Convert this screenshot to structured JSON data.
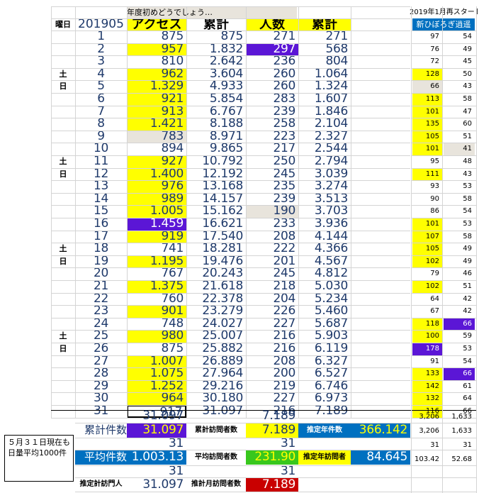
{
  "sheet": {
    "note_top": "年度初めどうでしょう…",
    "note_top_right": "2019年1月再スタート",
    "sub_header": "新ひぼろぎ逍遥",
    "headers": {
      "weekday": "曜日",
      "month": "201905",
      "access": "アクセス",
      "cum_access": "累計",
      "visitors": "人数",
      "cum_visitors": "累計"
    },
    "rows": [
      {
        "wd": "",
        "d": "1",
        "a": "875",
        "ca": "875",
        "v": "271",
        "cv": "271",
        "n1": "97",
        "n2": "54"
      },
      {
        "wd": "",
        "d": "2",
        "a": "957",
        "ca": "1.832",
        "v": "297",
        "cv": "568",
        "n1": "76",
        "n2": "49"
      },
      {
        "wd": "",
        "d": "3",
        "a": "810",
        "ca": "2.642",
        "v": "236",
        "cv": "804",
        "n1": "72",
        "n2": "45"
      },
      {
        "wd": "土",
        "d": "4",
        "a": "962",
        "ca": "3.604",
        "v": "260",
        "cv": "1.064",
        "n1": "128",
        "n2": "50"
      },
      {
        "wd": "日",
        "d": "5",
        "a": "1.329",
        "ca": "4.933",
        "v": "260",
        "cv": "1.324",
        "n1": "66",
        "n2": "43"
      },
      {
        "wd": "",
        "d": "6",
        "a": "921",
        "ca": "5.854",
        "v": "283",
        "cv": "1.607",
        "n1": "113",
        "n2": "58"
      },
      {
        "wd": "",
        "d": "7",
        "a": "913",
        "ca": "6.767",
        "v": "239",
        "cv": "1.846",
        "n1": "101",
        "n2": "47"
      },
      {
        "wd": "",
        "d": "8",
        "a": "1.421",
        "ca": "8.188",
        "v": "258",
        "cv": "2.104",
        "n1": "135",
        "n2": "60"
      },
      {
        "wd": "",
        "d": "9",
        "a": "783",
        "ca": "8.971",
        "v": "223",
        "cv": "2.327",
        "n1": "105",
        "n2": "51"
      },
      {
        "wd": "",
        "d": "10",
        "a": "894",
        "ca": "9.865",
        "v": "217",
        "cv": "2.544",
        "n1": "101",
        "n2": "41"
      },
      {
        "wd": "土",
        "d": "11",
        "a": "927",
        "ca": "10.792",
        "v": "250",
        "cv": "2.794",
        "n1": "95",
        "n2": "48"
      },
      {
        "wd": "日",
        "d": "12",
        "a": "1.400",
        "ca": "12.192",
        "v": "245",
        "cv": "3.039",
        "n1": "111",
        "n2": "43"
      },
      {
        "wd": "",
        "d": "13",
        "a": "976",
        "ca": "13.168",
        "v": "235",
        "cv": "3.274",
        "n1": "93",
        "n2": "53"
      },
      {
        "wd": "",
        "d": "14",
        "a": "989",
        "ca": "14.157",
        "v": "239",
        "cv": "3.513",
        "n1": "90",
        "n2": "58"
      },
      {
        "wd": "",
        "d": "15",
        "a": "1.005",
        "ca": "15.162",
        "v": "190",
        "cv": "3.703",
        "n1": "86",
        "n2": "54"
      },
      {
        "wd": "",
        "d": "16",
        "a": "1.459",
        "ca": "16.621",
        "v": "233",
        "cv": "3.936",
        "n1": "101",
        "n2": "53"
      },
      {
        "wd": "",
        "d": "17",
        "a": "919",
        "ca": "17.540",
        "v": "208",
        "cv": "4.144",
        "n1": "107",
        "n2": "58"
      },
      {
        "wd": "土",
        "d": "18",
        "a": "741",
        "ca": "18.281",
        "v": "222",
        "cv": "4.366",
        "n1": "105",
        "n2": "49"
      },
      {
        "wd": "日",
        "d": "19",
        "a": "1.195",
        "ca": "19.476",
        "v": "201",
        "cv": "4.567",
        "n1": "102",
        "n2": "49"
      },
      {
        "wd": "",
        "d": "20",
        "a": "767",
        "ca": "20.243",
        "v": "245",
        "cv": "4.812",
        "n1": "79",
        "n2": "46"
      },
      {
        "wd": "",
        "d": "21",
        "a": "1.375",
        "ca": "21.618",
        "v": "218",
        "cv": "5.030",
        "n1": "102",
        "n2": "51"
      },
      {
        "wd": "",
        "d": "22",
        "a": "760",
        "ca": "22.378",
        "v": "204",
        "cv": "5.234",
        "n1": "64",
        "n2": "42"
      },
      {
        "wd": "",
        "d": "23",
        "a": "901",
        "ca": "23.279",
        "v": "226",
        "cv": "5.460",
        "n1": "67",
        "n2": "42"
      },
      {
        "wd": "",
        "d": "24",
        "a": "748",
        "ca": "24.027",
        "v": "227",
        "cv": "5.687",
        "n1": "118",
        "n2": "66"
      },
      {
        "wd": "土",
        "d": "25",
        "a": "980",
        "ca": "25.007",
        "v": "216",
        "cv": "5.903",
        "n1": "100",
        "n2": "59"
      },
      {
        "wd": "日",
        "d": "26",
        "a": "875",
        "ca": "25.882",
        "v": "216",
        "cv": "6.119",
        "n1": "178",
        "n2": "53"
      },
      {
        "wd": "",
        "d": "27",
        "a": "1.007",
        "ca": "26.889",
        "v": "208",
        "cv": "6.327",
        "n1": "91",
        "n2": "54"
      },
      {
        "wd": "",
        "d": "28",
        "a": "1.075",
        "ca": "27.964",
        "v": "200",
        "cv": "6.527",
        "n1": "133",
        "n2": "66"
      },
      {
        "wd": "",
        "d": "29",
        "a": "1.252",
        "ca": "29.216",
        "v": "219",
        "cv": "6.746",
        "n1": "142",
        "n2": "61"
      },
      {
        "wd": "",
        "d": "30",
        "a": "964",
        "ca": "30.180",
        "v": "227",
        "cv": "6.973",
        "n1": "132",
        "n2": "64"
      },
      {
        "wd": "",
        "d": "31",
        "a": "917",
        "ca": "31.097",
        "v": "216",
        "cv": "7.189",
        "n1": "116",
        "n2": "66"
      }
    ],
    "colors": {
      "yellow": "#ffff00",
      "purple": "#5b16d6",
      "gray": "#e8e4dc",
      "green": "#38c71d",
      "red": "#c90000",
      "blue": "#0070c0",
      "navy": "#1f3a6b"
    },
    "summary": {
      "sum_access": "31.097",
      "sum_visitors": "7.189",
      "total_access_label": "累計件数",
      "total_access_value": "31.097",
      "cum_visitors_label": "累計訪問者数",
      "cum_visitors_value": "7.189",
      "est_year_label": "推定年件数",
      "est_year_value": "366.142",
      "days": "31",
      "days2": "31",
      "avg_label": "平均件数",
      "avg_value": "1.003.13",
      "avg_visitors_label": "平均訪問者数",
      "avg_visitors_value": "231.90",
      "est_year_visitors_label": "推定年訪問者",
      "est_year_visitors_value": "84.645",
      "est_month_label": "推定計訪門人",
      "est_month_value": "31.097",
      "est_month_visitors_label": "推計月訪問者数",
      "est_month_visitors_value": "7.189",
      "right_sum1": [
        "3,206",
        "1,633"
      ],
      "right_sum2": [
        "3,206",
        "1,633"
      ],
      "right_days": [
        "31",
        "31"
      ],
      "right_avg": [
        "103.42",
        "52.68"
      ]
    },
    "callout": "５月３１日現在も日量平均1000件"
  }
}
